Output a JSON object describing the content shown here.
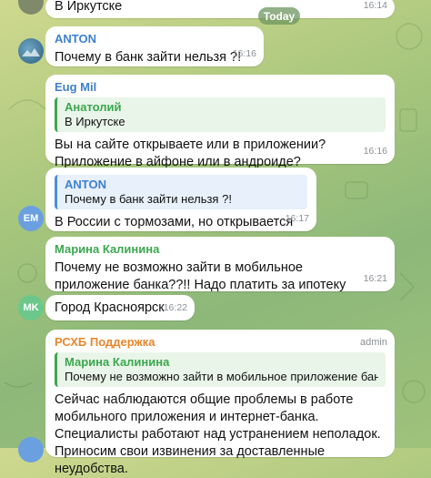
{
  "colors": {
    "background": "#a9c77d",
    "bubble": "#ffffff",
    "anton_name": "#3d80d0",
    "eug_name": "#3d80d0",
    "green_name": "#3ba84f",
    "orange_name": "#e9862c",
    "em_avatar": "#6a9fe0",
    "mk_avatar": "#6bc88a"
  },
  "date_pill": "Today",
  "messages": {
    "m0": {
      "text": "В Иркутске",
      "time": "16:14"
    },
    "m1": {
      "sender": "ANTON",
      "text": "Почему в банк зайти нельзя ?!",
      "time": "16:16"
    },
    "m2": {
      "sender": "Eug Mil",
      "reply_name": "Анатолий",
      "reply_text": "В Иркутске",
      "text": "Вы на сайте открываете или в приложении? Приложение в айфоне или в андроиде?",
      "time": "16:16"
    },
    "m3": {
      "avatar": "EM",
      "reply_name": "ANTON",
      "reply_text": "Почему в банк зайти нельзя ?!",
      "text": "В России с тормозами, но открывается",
      "time": "16:17"
    },
    "m4": {
      "sender": "Марина Калинина",
      "text": "Почему не возможно зайти в мобильное приложение банка??!! Надо платить за ипотеку",
      "time": "16:21"
    },
    "m5": {
      "avatar": "MK",
      "text": "Город Красноярск",
      "time": "16:22"
    },
    "m6": {
      "sender": "РСХБ Поддержка",
      "badge": "admin",
      "reply_name": "Марина Калинина",
      "reply_text": "Почему не возможно зайти в мобильное приложение банка??!! ...",
      "text": "Сейчас наблюдаются общие проблемы в работе мобильного приложения и интернет-банка. Специалисты работают над устранением неполадок. Приносим свои извинения за доставленные неудобства."
    }
  }
}
